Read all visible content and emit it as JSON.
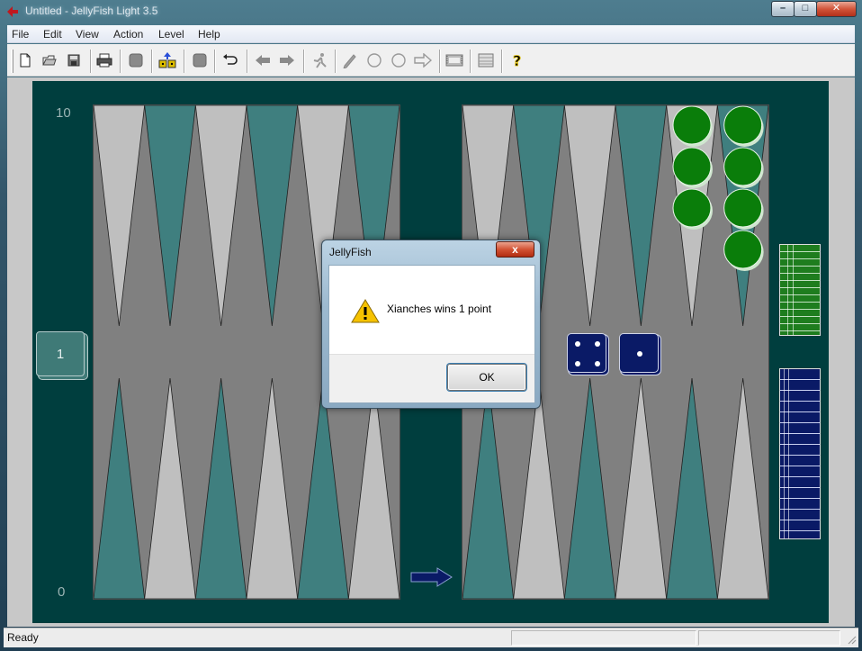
{
  "window": {
    "title": "Untitled - JellyFish Light 3.5",
    "minimize_glyph": "–",
    "maximize_glyph": "□",
    "close_glyph": "✕"
  },
  "menu": {
    "items": [
      "File",
      "Edit",
      "View",
      "Action",
      "Level",
      "Help"
    ]
  },
  "toolbar": {
    "icons": [
      "new-icon",
      "open-icon",
      "save-icon",
      "print-icon",
      "stop-icon",
      "dice-up-icon",
      "stop-icon",
      "undo-icon",
      "back-arrow-icon",
      "forward-arrow-icon",
      "runner-icon",
      "pencil-icon",
      "circle-icon",
      "circle-icon",
      "right-arrow-icon",
      "film-icon",
      "grid-icon",
      "help-icon"
    ]
  },
  "board": {
    "pip_top_label": "10",
    "pip_bottom_label": "0",
    "cube_value": "1",
    "colors": {
      "frame": "#003e3e",
      "field": "#808080",
      "point_light": "#bfbfbf",
      "point_teal": "#3f7f7f",
      "checker_green": "#0a7d0a",
      "checker_blue": "#0a1a66"
    },
    "dice": [
      4,
      1
    ]
  },
  "status": {
    "text": "Ready"
  },
  "dialog": {
    "title": "JellyFish",
    "message": "Xianches wins 1 point",
    "ok_label": "OK",
    "close_glyph": "x",
    "icon": "warning-icon"
  }
}
